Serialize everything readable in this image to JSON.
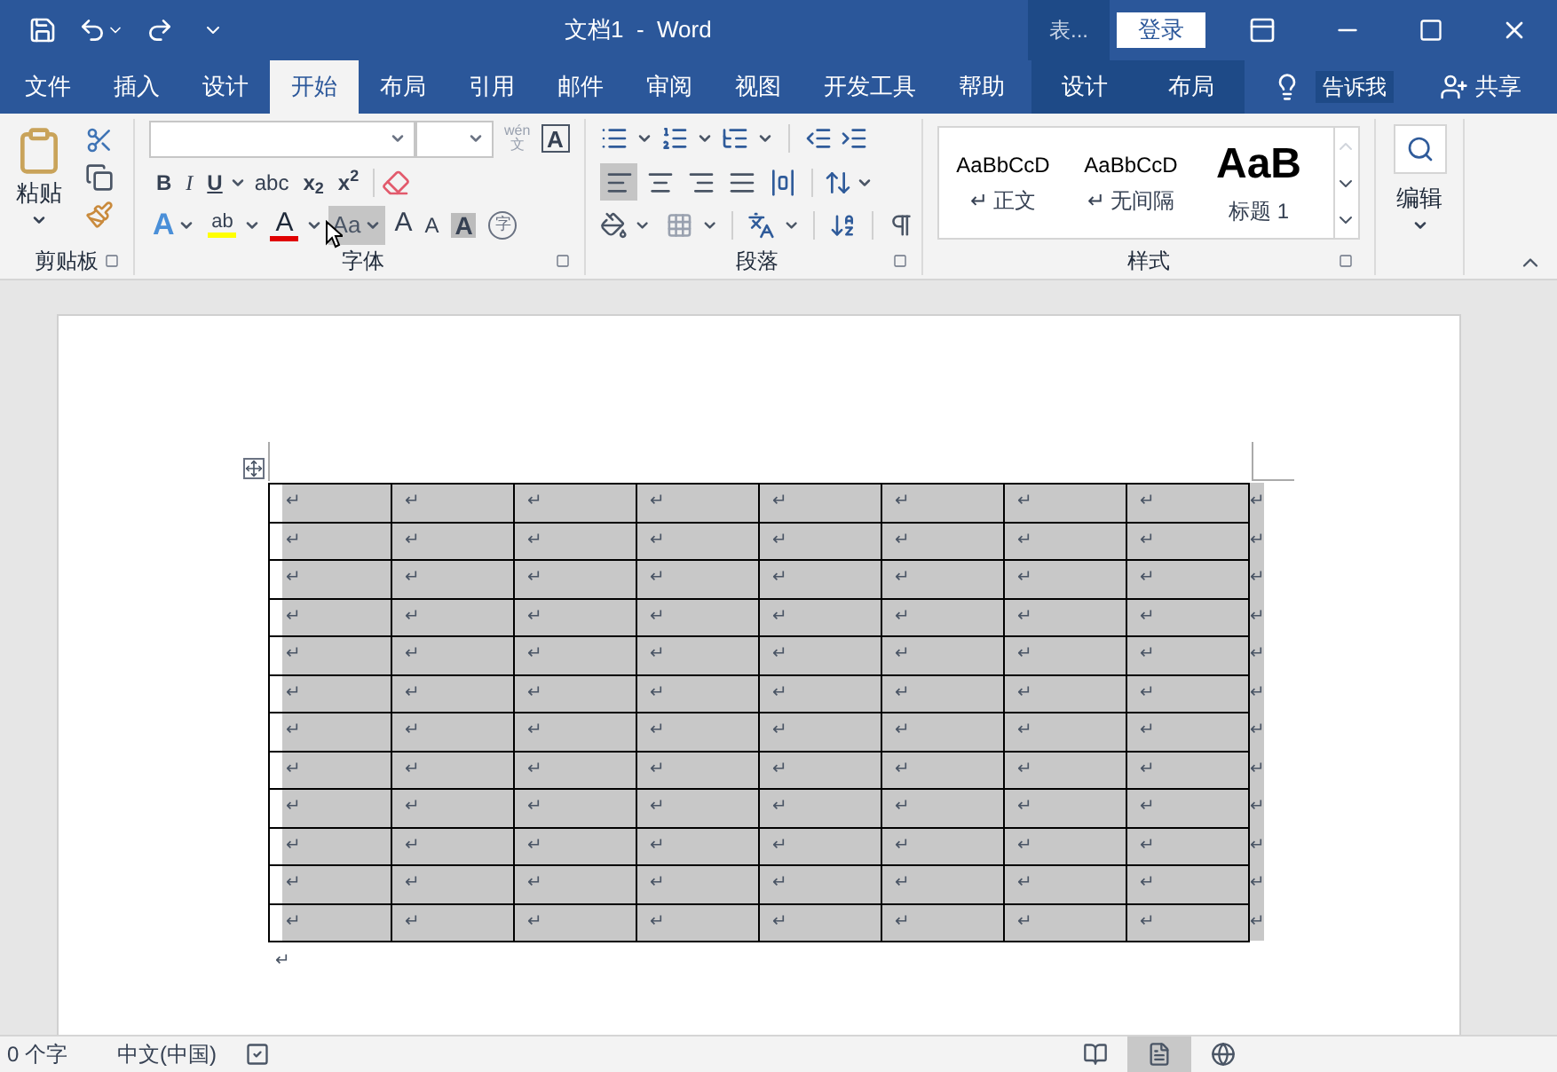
{
  "window": {
    "title": "文档1  -  Word",
    "context_label": "表...",
    "sign_in": "登录"
  },
  "tabs": [
    {
      "label": "文件",
      "selected": false,
      "kind": "normal"
    },
    {
      "label": "插入",
      "selected": false,
      "kind": "normal"
    },
    {
      "label": "设计",
      "selected": false,
      "kind": "normal"
    },
    {
      "label": "开始",
      "selected": true,
      "kind": "normal"
    },
    {
      "label": "布局",
      "selected": false,
      "kind": "normal"
    },
    {
      "label": "引用",
      "selected": false,
      "kind": "normal"
    },
    {
      "label": "邮件",
      "selected": false,
      "kind": "normal"
    },
    {
      "label": "审阅",
      "selected": false,
      "kind": "normal"
    },
    {
      "label": "视图",
      "selected": false,
      "kind": "normal"
    },
    {
      "label": "开发工具",
      "selected": false,
      "kind": "normal"
    },
    {
      "label": "帮助",
      "selected": false,
      "kind": "normal"
    },
    {
      "label": "设计",
      "selected": false,
      "kind": "context"
    },
    {
      "label": "布局",
      "selected": false,
      "kind": "context"
    }
  ],
  "tell_me": "告诉我",
  "share": "共享",
  "clipboard": {
    "paste": "粘贴",
    "group": "剪贴板"
  },
  "font": {
    "group": "字体",
    "phonetic": [
      "wén",
      "文"
    ],
    "border_char": "A",
    "format": [
      {
        "label": "B",
        "kind": "bold"
      },
      {
        "label": "I",
        "kind": "italic"
      },
      {
        "label": "U",
        "kind": "underline"
      },
      {
        "label": "abc",
        "kind": "strike"
      },
      {
        "label": "x$_{2}$",
        "kind": "sub"
      },
      {
        "label": "x$^{2}$",
        "kind": "sup"
      }
    ],
    "effects": [
      {
        "label": "A",
        "kind": "text_effect",
        "hovered": false
      },
      {
        "label": "ab",
        "kind": "highlight",
        "color": "#ffff00",
        "hovered": false
      },
      {
        "label": "A",
        "kind": "font_color",
        "color": "#e00000",
        "hovered": false
      },
      {
        "label": "Aa",
        "kind": "case",
        "hovered": true
      },
      {
        "label": "A",
        "kind": "grow",
        "hovered": false
      },
      {
        "label": "A",
        "kind": "shrink",
        "hovered": false
      },
      {
        "label": "A",
        "kind": "shading",
        "hovered": false
      },
      {
        "label": "字",
        "kind": "enclose",
        "hovered": false
      }
    ]
  },
  "paragraph": {
    "group": "段落",
    "alignment": [
      {
        "kind": "left",
        "selected": true
      },
      {
        "kind": "center",
        "selected": false
      },
      {
        "kind": "right",
        "selected": false
      },
      {
        "kind": "justify",
        "selected": false
      },
      {
        "kind": "distributed",
        "selected": false
      }
    ]
  },
  "styles": {
    "group": "样式",
    "items": [
      {
        "sample": "AaBbCcD",
        "mark": "↵",
        "name": "正文",
        "kind": "body"
      },
      {
        "sample": "AaBbCcD",
        "mark": "↵",
        "name": "无间隔",
        "kind": "body"
      },
      {
        "sample": "AaB",
        "name": "标题 1",
        "kind": "heading"
      }
    ]
  },
  "editing": {
    "label": "编辑"
  },
  "document": {
    "table": {
      "selected": true,
      "rows": [
        {
          "cells": [
            "↵",
            "↵",
            "↵",
            "↵",
            "↵",
            "↵",
            "↵",
            "↵"
          ],
          "end": "↵"
        },
        {
          "cells": [
            "↵",
            "↵",
            "↵",
            "↵",
            "↵",
            "↵",
            "↵",
            "↵"
          ],
          "end": "↵"
        },
        {
          "cells": [
            "↵",
            "↵",
            "↵",
            "↵",
            "↵",
            "↵",
            "↵",
            "↵"
          ],
          "end": "↵"
        },
        {
          "cells": [
            "↵",
            "↵",
            "↵",
            "↵",
            "↵",
            "↵",
            "↵",
            "↵"
          ],
          "end": "↵"
        },
        {
          "cells": [
            "↵",
            "↵",
            "↵",
            "↵",
            "↵",
            "↵",
            "↵",
            "↵"
          ],
          "end": "↵"
        },
        {
          "cells": [
            "↵",
            "↵",
            "↵",
            "↵",
            "↵",
            "↵",
            "↵",
            "↵"
          ],
          "end": "↵"
        },
        {
          "cells": [
            "↵",
            "↵",
            "↵",
            "↵",
            "↵",
            "↵",
            "↵",
            "↵"
          ],
          "end": "↵"
        },
        {
          "cells": [
            "↵",
            "↵",
            "↵",
            "↵",
            "↵",
            "↵",
            "↵",
            "↵"
          ],
          "end": "↵"
        },
        {
          "cells": [
            "↵",
            "↵",
            "↵",
            "↵",
            "↵",
            "↵",
            "↵",
            "↵"
          ],
          "end": "↵"
        },
        {
          "cells": [
            "↵",
            "↵",
            "↵",
            "↵",
            "↵",
            "↵",
            "↵",
            "↵"
          ],
          "end": "↵"
        },
        {
          "cells": [
            "↵",
            "↵",
            "↵",
            "↵",
            "↵",
            "↵",
            "↵",
            "↵"
          ],
          "end": "↵"
        },
        {
          "cells": [
            "↵",
            "↵",
            "↵",
            "↵",
            "↵",
            "↵",
            "↵",
            "↵"
          ],
          "end": "↵"
        }
      ]
    },
    "after_mark": "↵"
  },
  "status_bar": {
    "word_count": "0 个字",
    "language": "中文(中国)",
    "views": [
      {
        "kind": "read",
        "selected": false
      },
      {
        "kind": "print",
        "selected": true
      },
      {
        "kind": "web",
        "selected": false
      }
    ]
  }
}
